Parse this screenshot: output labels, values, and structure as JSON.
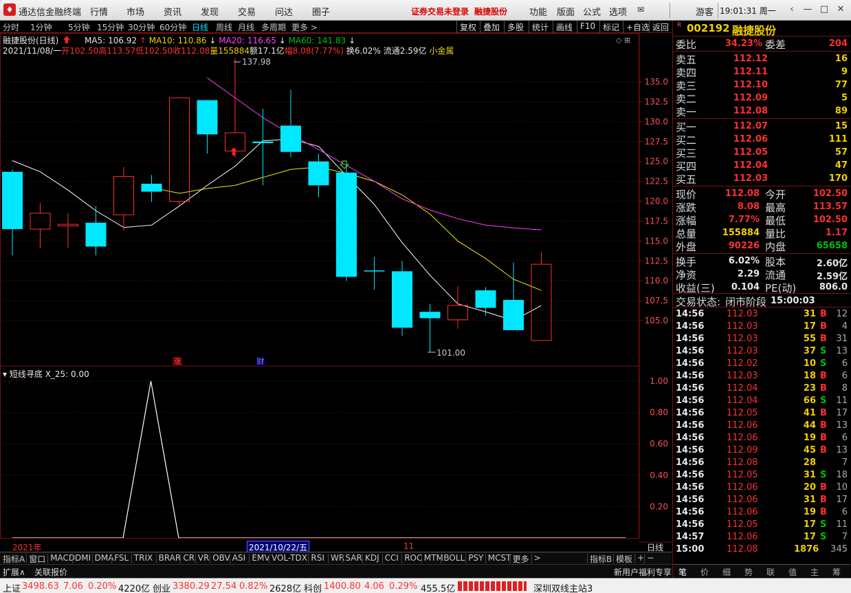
{
  "menubar": {
    "app_title": "通达信金融终端",
    "items": [
      "行情",
      "市场",
      "资讯",
      "发现",
      "交易",
      "问达",
      "圈子"
    ],
    "alert": "证券交易未登录",
    "stock": "融捷股份",
    "right_items": [
      "功能",
      "版面",
      "公式",
      "选项"
    ],
    "guest": "游客",
    "clock": "19:01:31 周一"
  },
  "periods": [
    "分时",
    "1分钟",
    "5分钟",
    "15分钟",
    "30分钟",
    "60分钟",
    "日线",
    "周线",
    "月线",
    "多周期",
    "更多 >"
  ],
  "active_period": "日线",
  "toolbar_buttons": [
    "复权",
    "叠加",
    "多股",
    "统计",
    "画线",
    "F10",
    "标记",
    "+自选",
    "返回"
  ],
  "chart_header": {
    "name": "融捷股份(日线)",
    "ma5": "MA5: 106.92",
    "ma10": "MA10: 110.86",
    "ma20": "MA20: 116.65",
    "ma60": "MA60: 141.83",
    "date": "2021/11/08/一",
    "open": "开102.50",
    "high": "高113.57",
    "low": "低102.50",
    "close": "收112.08",
    "volume": "量155884",
    "amount": "额17.1亿",
    "change": "幅8.08(7.77%)",
    "turnover": "换6.02%",
    "float": "流通2.59亿",
    "sector": "小金属"
  },
  "annotations": {
    "high_mark": "137.98",
    "low_mark": "101.00",
    "badge_rise": "涨",
    "badge_finance": "财"
  },
  "indicator": {
    "name": "短线寻底",
    "value": "X_25: 0.00",
    "axis": [
      "1.00",
      "0.80",
      "0.60",
      "0.40",
      "0.20"
    ]
  },
  "x_axis": {
    "left": "2021年",
    "cursor": "2021/10/22/五",
    "month": "11",
    "period": "日线"
  },
  "indicator_tabs": [
    "指标A",
    "窗口",
    "MACD",
    "DMI",
    "DMA",
    "FSL",
    "TRIX",
    "BRAR",
    "CR",
    "VR",
    "OBV",
    "ASI",
    "EMV",
    "VOL-TDX",
    "RSI",
    "WR",
    "SAR",
    "KDJ",
    "CCI",
    "ROC",
    "MTM",
    "BOLL",
    "PSY",
    "MCST",
    "更多",
    ">",
    "指标B",
    "模板",
    "+",
    "−"
  ],
  "bottom_left": [
    "扩展∧",
    "关联报价"
  ],
  "bottom_right_ad": "新用户福利专享",
  "quote": {
    "code": "002192",
    "name": "融捷股份",
    "wei_bi_label": "委比",
    "wei_bi": "34.23%",
    "wei_cha_label": "委差",
    "wei_cha": "204",
    "asks": [
      {
        "label": "卖五",
        "price": "112.12",
        "vol": "16"
      },
      {
        "label": "卖四",
        "price": "112.11",
        "vol": "9"
      },
      {
        "label": "卖三",
        "price": "112.10",
        "vol": "77"
      },
      {
        "label": "卖二",
        "price": "112.09",
        "vol": "5"
      },
      {
        "label": "卖一",
        "price": "112.08",
        "vol": "89"
      }
    ],
    "bids": [
      {
        "label": "买一",
        "price": "112.07",
        "vol": "15"
      },
      {
        "label": "买二",
        "price": "112.06",
        "vol": "111"
      },
      {
        "label": "买三",
        "price": "112.05",
        "vol": "57"
      },
      {
        "label": "买四",
        "price": "112.04",
        "vol": "47"
      },
      {
        "label": "买五",
        "price": "112.03",
        "vol": "170"
      }
    ],
    "stats": [
      {
        "l1": "现价",
        "v1": "112.08",
        "l2": "今开",
        "v2": "102.50"
      },
      {
        "l1": "涨跌",
        "v1": "8.08",
        "l2": "最高",
        "v2": "113.57"
      },
      {
        "l1": "涨幅",
        "v1": "7.77%",
        "l2": "最低",
        "v2": "102.50"
      },
      {
        "l1": "总量",
        "v1": "155884",
        "l2": "量比",
        "v2": "1.17"
      },
      {
        "l1": "外盘",
        "v1": "90226",
        "l2": "内盘",
        "v2": "65658"
      }
    ],
    "stats2": [
      {
        "l1": "换手",
        "v1": "6.02%",
        "l2": "股本",
        "v2": "2.60亿"
      },
      {
        "l1": "净资",
        "v1": "2.29",
        "l2": "流通",
        "v2": "2.59亿"
      },
      {
        "l1": "收益(三)",
        "v1": "0.104",
        "l2": "PE(动)",
        "v2": "806.0"
      }
    ],
    "trade_status_label": "交易状态:",
    "trade_status": "闭市阶段",
    "trade_time": "15:00:03",
    "ticks": [
      {
        "t": "14:56",
        "p": "112.03",
        "v": "31",
        "s": "B",
        "n": "12"
      },
      {
        "t": "14:56",
        "p": "112.03",
        "v": "17",
        "s": "B",
        "n": "4"
      },
      {
        "t": "14:56",
        "p": "112.03",
        "v": "55",
        "s": "B",
        "n": "31"
      },
      {
        "t": "14:56",
        "p": "112.03",
        "v": "37",
        "s": "S",
        "n": "13"
      },
      {
        "t": "14:56",
        "p": "112.02",
        "v": "10",
        "s": "S",
        "n": "6"
      },
      {
        "t": "14:56",
        "p": "112.03",
        "v": "18",
        "s": "B",
        "n": "6"
      },
      {
        "t": "14:56",
        "p": "112.04",
        "v": "23",
        "s": "B",
        "n": "8"
      },
      {
        "t": "14:56",
        "p": "112.04",
        "v": "66",
        "s": "S",
        "n": "11"
      },
      {
        "t": "14:56",
        "p": "112.05",
        "v": "41",
        "s": "B",
        "n": "17"
      },
      {
        "t": "14:56",
        "p": "112.06",
        "v": "44",
        "s": "B",
        "n": "13"
      },
      {
        "t": "14:56",
        "p": "112.06",
        "v": "19",
        "s": "B",
        "n": "6"
      },
      {
        "t": "14:56",
        "p": "112.09",
        "v": "45",
        "s": "B",
        "n": "13"
      },
      {
        "t": "14:56",
        "p": "112.08",
        "v": "28",
        "s": "",
        "n": "7"
      },
      {
        "t": "14:56",
        "p": "112.05",
        "v": "31",
        "s": "S",
        "n": "18"
      },
      {
        "t": "14:56",
        "p": "112.06",
        "v": "20",
        "s": "B",
        "n": "10"
      },
      {
        "t": "14:56",
        "p": "112.06",
        "v": "31",
        "s": "B",
        "n": "17"
      },
      {
        "t": "14:56",
        "p": "112.06",
        "v": "19",
        "s": "B",
        "n": "6"
      },
      {
        "t": "14:56",
        "p": "112.05",
        "v": "17",
        "s": "S",
        "n": "11"
      },
      {
        "t": "14:57",
        "p": "112.06",
        "v": "17",
        "s": "S",
        "n": "7"
      },
      {
        "t": "15:00",
        "p": "112.08",
        "v": "1876",
        "s": "",
        "n": "345"
      }
    ],
    "bottom_tabs": [
      "笔",
      "价",
      "细",
      "势",
      "联",
      "值",
      "主",
      "筹"
    ]
  },
  "statusbar": {
    "sh_label": "上证",
    "sh_val": "3498.63",
    "sh_chg": "7.06",
    "sh_pct": "0.20%",
    "sh_amt": "4220亿",
    "cy_label": "创业",
    "cy_val": "3380.29",
    "cy_chg": "27.54",
    "cy_pct": "0.82%",
    "cy_amt": "2628亿",
    "kc_label": "科创",
    "kc_val": "1400.80",
    "kc_chg": "4.06",
    "kc_pct": "0.29%",
    "kc_amt": "455.5亿",
    "server": "深圳双线主站3"
  },
  "colors": {
    "up": "#ff3030",
    "down": "#00e8ff",
    "ma5": "#ffffff",
    "ma10": "#f0f000",
    "ma20": "#ff40ff",
    "ma60": "#00ff00",
    "grid": "#7a1010"
  },
  "chart_data": {
    "type": "candlestick",
    "price_axis": [
      135.0,
      132.5,
      130.0,
      127.5,
      125.0,
      122.5,
      120.0,
      117.5,
      115.0,
      112.5,
      110.0,
      107.5,
      105.0
    ],
    "candles": [
      {
        "o": 123.7,
        "c": 116.5,
        "h": 124.0,
        "l": 113.2
      },
      {
        "o": 116.5,
        "c": 118.5,
        "h": 119.8,
        "l": 114.1
      },
      {
        "o": 116.9,
        "c": 117.1,
        "h": 118.5,
        "l": 114.1
      },
      {
        "o": 117.3,
        "c": 114.3,
        "h": 119.4,
        "l": 113.2
      },
      {
        "o": 118.3,
        "c": 123.1,
        "h": 124.3,
        "l": 116.3
      },
      {
        "o": 122.2,
        "c": 121.2,
        "h": 123.3,
        "l": 119.9
      },
      {
        "o": 120.0,
        "c": 133.0,
        "h": 133.0,
        "l": 119.5
      },
      {
        "o": 132.7,
        "c": 128.4,
        "h": 132.7,
        "l": 126.0
      },
      {
        "o": 126.3,
        "c": 128.6,
        "h": 137.98,
        "l": 125.5
      },
      {
        "o": 127.5,
        "c": 127.3,
        "h": 131.6,
        "l": 122.0
      },
      {
        "o": 129.5,
        "c": 126.2,
        "h": 134.0,
        "l": 125.5
      },
      {
        "o": 125.0,
        "c": 122.0,
        "h": 126.0,
        "l": 120.5
      },
      {
        "o": 123.6,
        "c": 110.5,
        "h": 124.5,
        "l": 110.0
      },
      {
        "o": 111.3,
        "c": 111.2,
        "h": 113.0,
        "l": 108.9
      },
      {
        "o": 111.2,
        "c": 104.1,
        "h": 112.5,
        "l": 103.1
      },
      {
        "o": 106.1,
        "c": 105.3,
        "h": 107.1,
        "l": 101.0
      },
      {
        "o": 105.1,
        "c": 106.9,
        "h": 109.3,
        "l": 104.0
      },
      {
        "o": 108.8,
        "c": 106.6,
        "h": 109.2,
        "l": 105.6
      },
      {
        "o": 107.6,
        "c": 103.8,
        "h": 112.3,
        "l": 103.8
      },
      {
        "o": 102.5,
        "c": 112.08,
        "h": 113.57,
        "l": 102.5
      }
    ],
    "ma5": [
      125.1,
      123.7,
      121.4,
      118.8,
      116.7,
      117.0,
      119.4,
      122.0,
      124.4,
      127.6,
      127.8,
      126.9,
      123.2,
      119.6,
      114.8,
      110.7,
      107.1,
      106.1,
      105.0,
      106.9
    ],
    "ma10": [
      null,
      null,
      null,
      null,
      null,
      121.7,
      121.0,
      121.6,
      122.0,
      123.0,
      124.0,
      124.3,
      123.5,
      122.5,
      120.8,
      118.4,
      115.0,
      112.8,
      110.2,
      108.8
    ],
    "ma20": [
      null,
      null,
      null,
      null,
      null,
      null,
      null,
      135.5,
      133.0,
      130.5,
      128.4,
      126.5,
      124.5,
      122.5,
      120.3,
      118.9,
      117.8,
      117.0,
      116.65,
      116.4
    ],
    "indicator_values": [
      0,
      0,
      0,
      1.0,
      0,
      0,
      0,
      0,
      0,
      0,
      0,
      0,
      0,
      0,
      0,
      0,
      0,
      0,
      0,
      0
    ],
    "indicator_ylim": [
      0,
      1.0
    ]
  }
}
